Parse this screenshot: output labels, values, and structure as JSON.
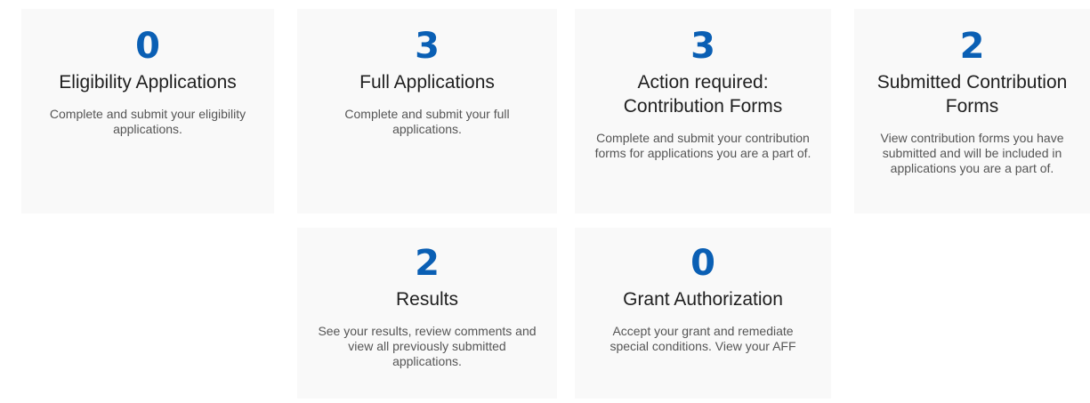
{
  "colors": {
    "count": "#0a5fb4",
    "title": "#1f1f1f",
    "description": "#555555",
    "card_background": "#f9f9f9"
  },
  "cards": [
    {
      "count": "0",
      "title": "Eligibility Applications",
      "description": "Complete and submit your eligibility applications."
    },
    {
      "count": "3",
      "title": "Full Applications",
      "description": "Complete and submit your full applications."
    },
    {
      "count": "3",
      "title": "Action required: Contribution Forms",
      "description": "Complete and submit your contribution forms for applications you are a part of."
    },
    {
      "count": "2",
      "title": "Submitted Contribution Forms",
      "description": "View contribution forms you have submitted and will be included in applications you are a part of."
    },
    {
      "count": "2",
      "title": "Results",
      "description": "See your results, review comments and view all previously submitted applications."
    },
    {
      "count": "0",
      "title": "Grant Authorization",
      "description": "Accept your grant and remediate special conditions. View your AFF"
    }
  ]
}
